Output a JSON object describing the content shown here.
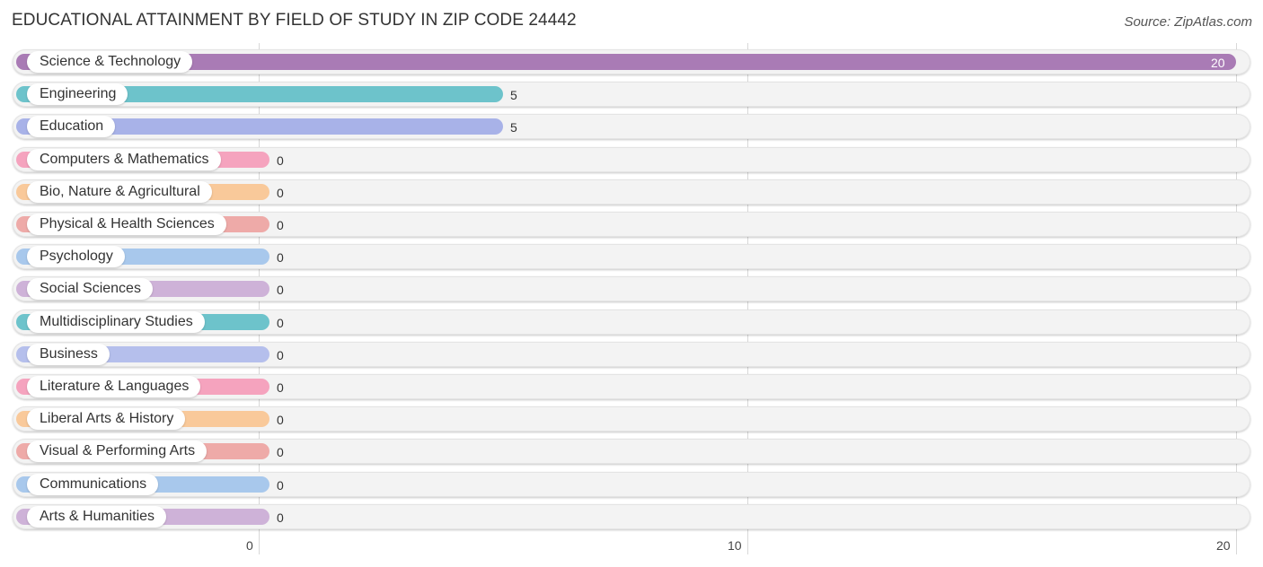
{
  "header": {
    "title": "EDUCATIONAL ATTAINMENT BY FIELD OF STUDY IN ZIP CODE 24442",
    "source": "Source: ZipAtlas.com"
  },
  "chart_data": {
    "type": "bar",
    "orientation": "horizontal",
    "title": "EDUCATIONAL ATTAINMENT BY FIELD OF STUDY IN ZIP CODE 24442",
    "xlabel": "",
    "ylabel": "",
    "xlim": [
      0,
      20
    ],
    "x_ticks": [
      "0",
      "10",
      "20"
    ],
    "grid": true,
    "legend": "none",
    "categories": [
      "Science & Technology",
      "Engineering",
      "Education",
      "Computers & Mathematics",
      "Bio, Nature & Agricultural",
      "Physical & Health Sciences",
      "Psychology",
      "Social Sciences",
      "Multidisciplinary Studies",
      "Business",
      "Literature & Languages",
      "Liberal Arts & History",
      "Visual & Performing Arts",
      "Communications",
      "Arts & Humanities"
    ],
    "values": [
      20,
      5,
      5,
      0,
      0,
      0,
      0,
      0,
      0,
      0,
      0,
      0,
      0,
      0,
      0
    ],
    "value_labels": [
      "20",
      "5",
      "5",
      "0",
      "0",
      "0",
      "0",
      "0",
      "0",
      "0",
      "0",
      "0",
      "0",
      "0",
      "0"
    ],
    "colors": [
      "#a97bb5",
      "#6dc3cb",
      "#a8b2e8",
      "#f5a3be",
      "#f9c99a",
      "#eeaaa8",
      "#a8c8ec",
      "#ceb2d8",
      "#6dc3cb",
      "#b5bfec",
      "#f5a3be",
      "#f9c99a",
      "#eeaaa8",
      "#a8c8ec",
      "#ceb2d8"
    ]
  }
}
